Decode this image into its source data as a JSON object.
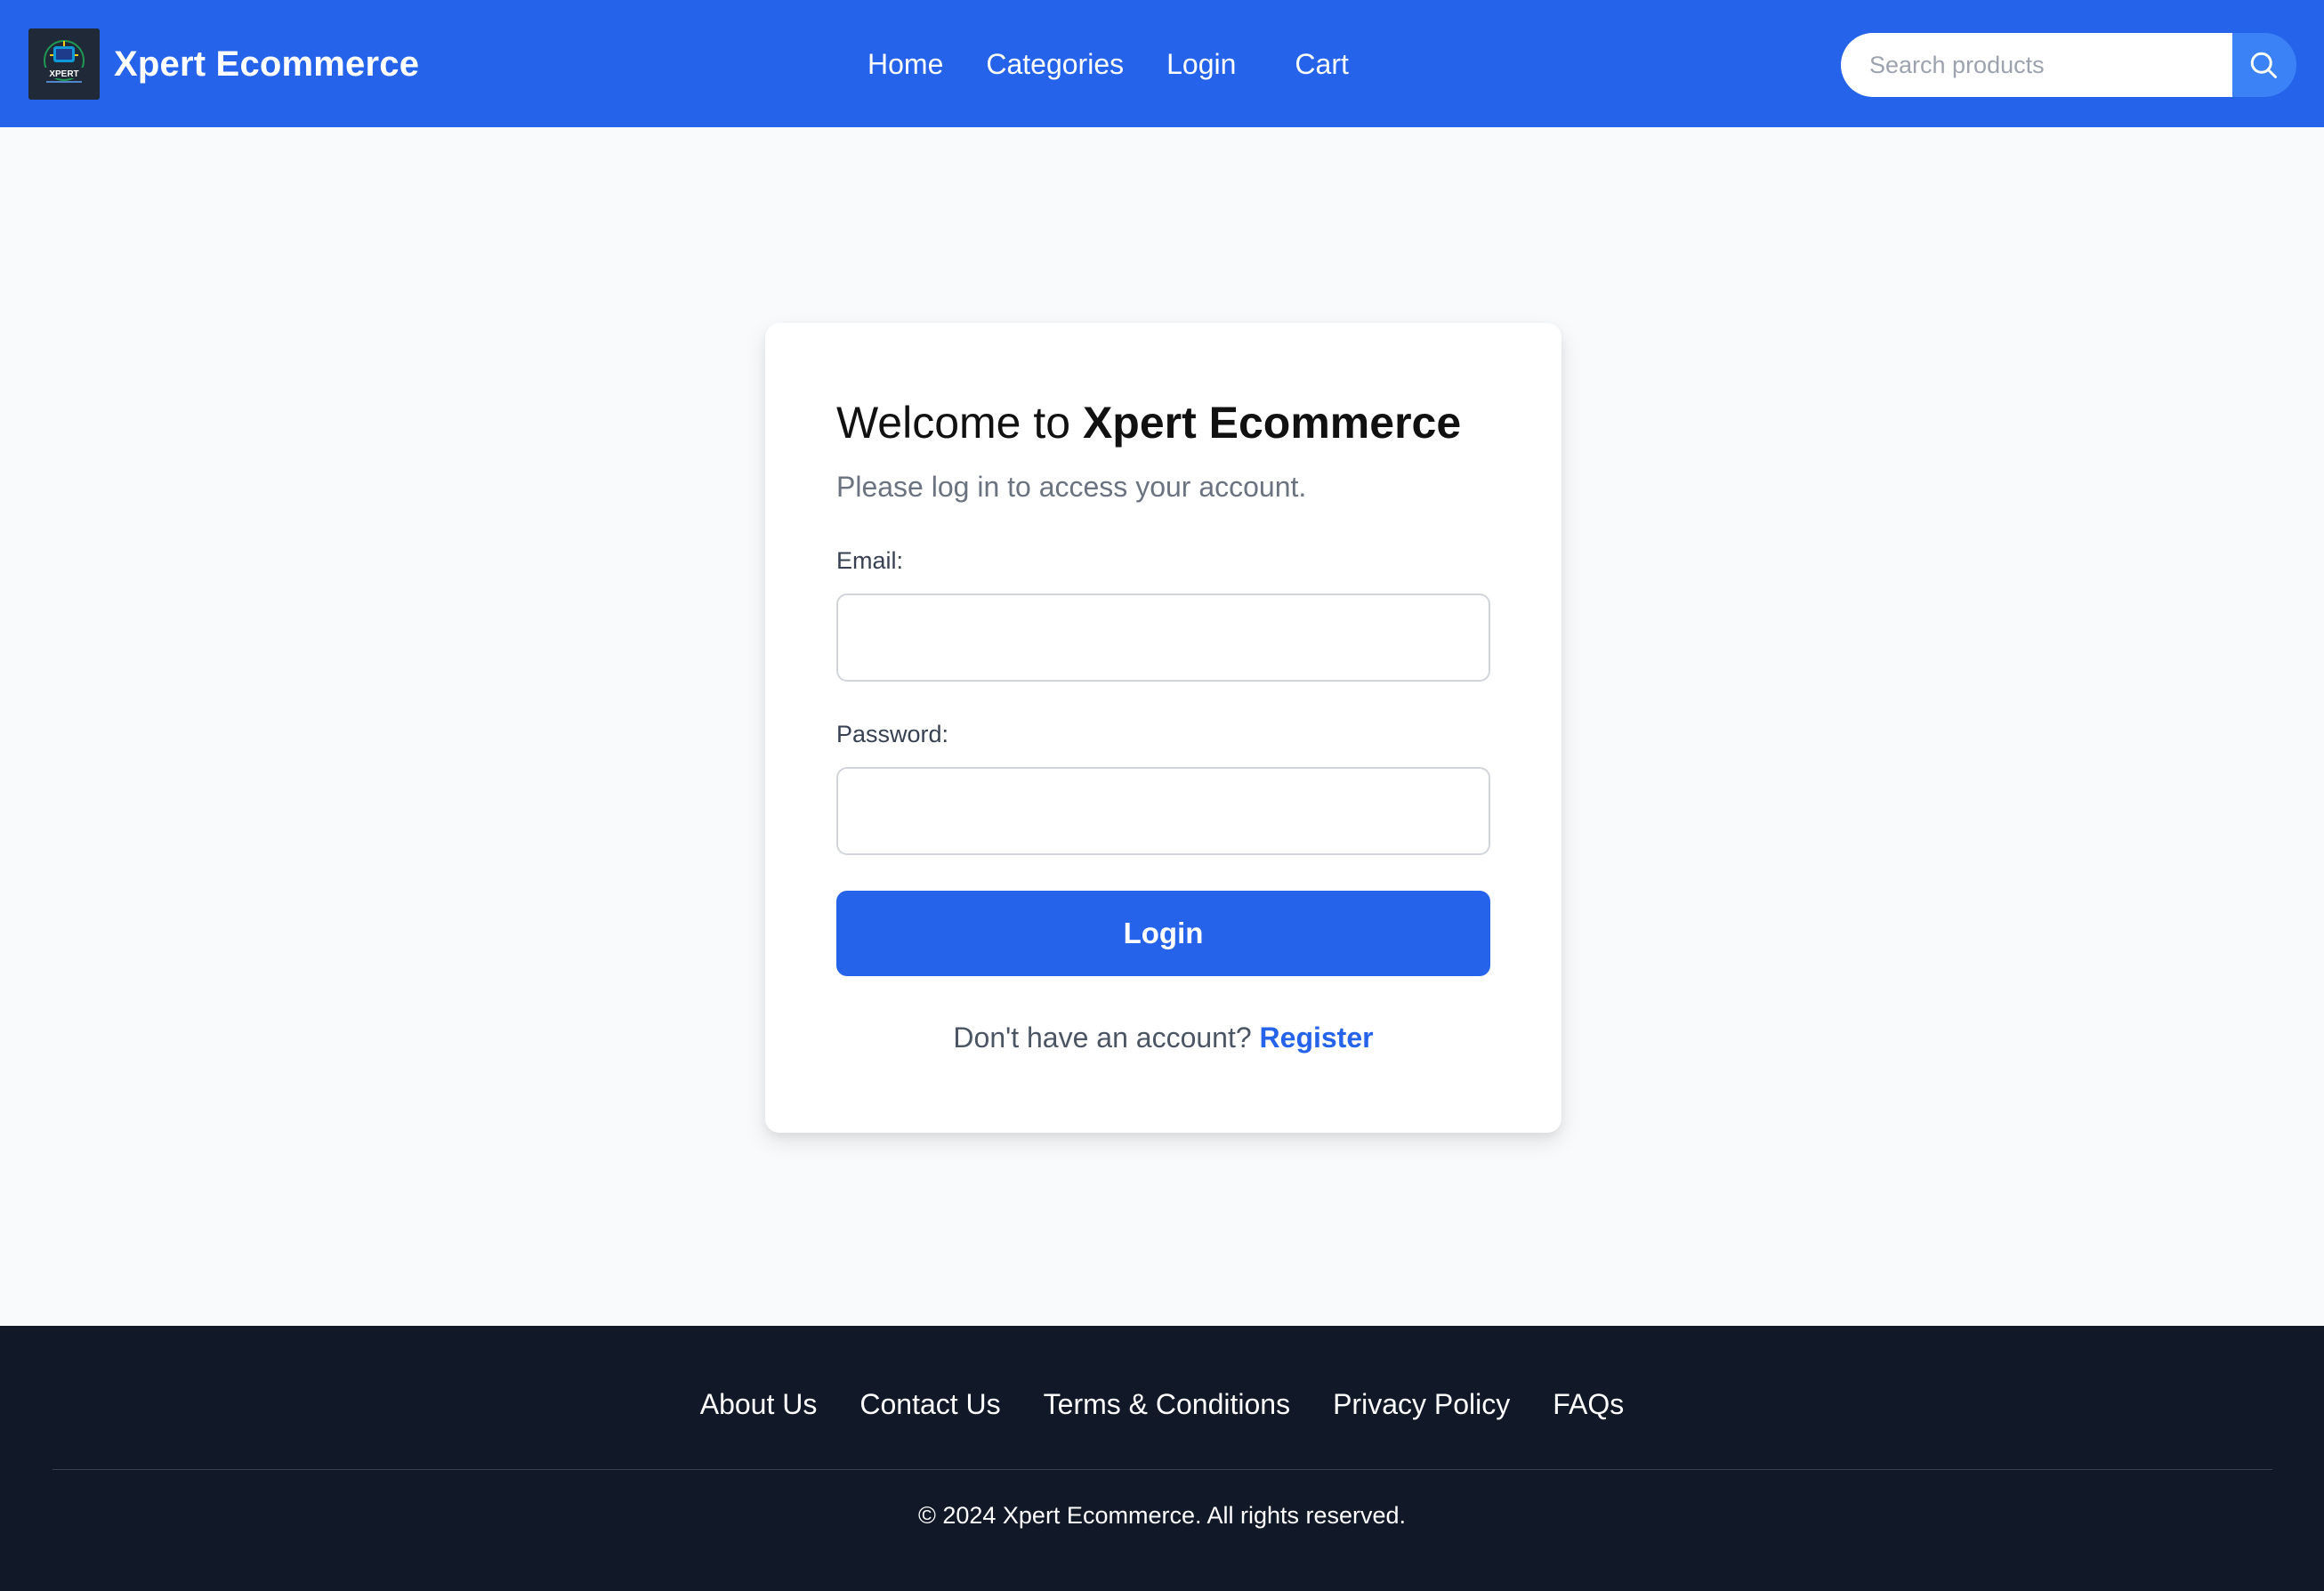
{
  "header": {
    "brand_name": "Xpert Ecommerce",
    "logo_text": "XPERT",
    "nav": [
      {
        "label": "Home"
      },
      {
        "label": "Categories"
      },
      {
        "label": "Login"
      },
      {
        "label": "Cart"
      }
    ],
    "search": {
      "placeholder": "Search products",
      "value": "",
      "icon": "search-icon"
    }
  },
  "login_card": {
    "title_prefix": "Welcome to ",
    "title_brand": "Xpert Ecommerce",
    "subtitle": "Please log in to access your account.",
    "email_label": "Email:",
    "email_value": "",
    "password_label": "Password:",
    "password_value": "",
    "submit_label": "Login",
    "register_prompt": "Don't have an account?",
    "register_link": "Register"
  },
  "footer": {
    "links": [
      {
        "label": "About Us"
      },
      {
        "label": "Contact Us"
      },
      {
        "label": "Terms & Conditions"
      },
      {
        "label": "Privacy Policy"
      },
      {
        "label": "FAQs"
      }
    ],
    "copyright": "© 2024 Xpert Ecommerce. All rights reserved."
  },
  "colors": {
    "primary": "#2563eb",
    "header_bg": "#2563eb",
    "page_bg": "#f8fafc",
    "footer_bg": "#111827",
    "link": "#2563eb"
  }
}
